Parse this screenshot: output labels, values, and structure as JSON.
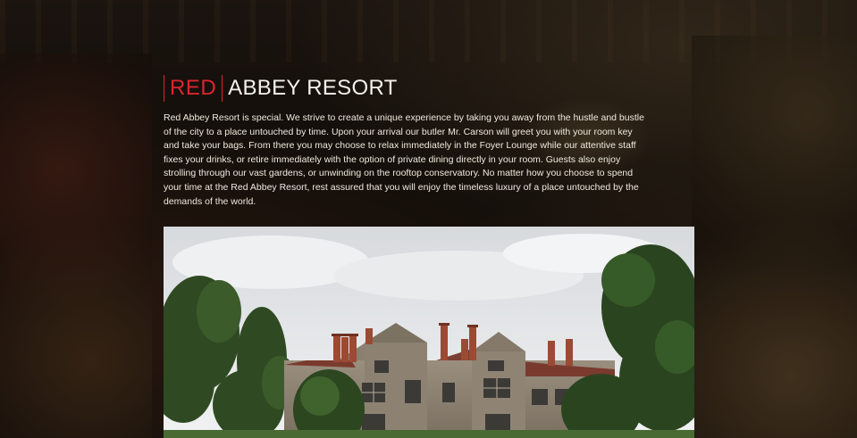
{
  "brand": {
    "name_accent": "RED",
    "name_rest": "ABBEY RESORT",
    "accent_color": "#d9272e"
  },
  "intro": {
    "text": "Red Abbey Resort is special. We strive to create a unique experience by taking you away from the hustle and bustle of the city to a place untouched by time. Upon your arrival our butler Mr. Carson will greet you with your room key and take your bags. From there you may choose to relax immediately in the Foyer Lounge while our attentive staff fixes your drinks, or retire immediately with the option of private dining directly in your room. Guests also enjoy strolling through our vast gardens, or unwinding on the rooftop conservatory. No matter how you choose to spend your time at the Red Abbey Resort, rest assured that you will enjoy the timeless luxury of a place untouched by the demands of the world."
  },
  "photo": {
    "subject": "manor-house-photo"
  }
}
